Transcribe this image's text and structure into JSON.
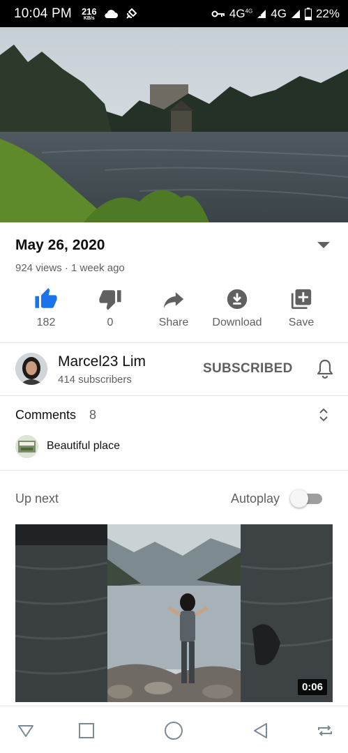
{
  "status_bar": {
    "time": "10:04 PM",
    "speed_value": "216",
    "speed_unit": "KB/s",
    "network_1": "4G",
    "network_1_sup": "4G",
    "network_2": "4G",
    "battery": "22%"
  },
  "video": {
    "date_title": "May 26, 2020",
    "views_line": "924 views · 1 week ago"
  },
  "actions": {
    "like_count": "182",
    "dislike_count": "0",
    "share_label": "Share",
    "download_label": "Download",
    "save_label": "Save"
  },
  "channel": {
    "name": "Marcel23 Lim",
    "subscribers": "414 subscribers",
    "subscribe_state": "SUBSCRIBED"
  },
  "comments": {
    "title": "Comments",
    "count": "8",
    "top_comment": "Beautiful place"
  },
  "up_next": {
    "label": "Up next",
    "autoplay_label": "Autoplay",
    "autoplay_on": false,
    "duration": "0:06"
  },
  "colors": {
    "accent_blue": "#1a73e8",
    "icon_gray": "#606060",
    "text_primary": "#0f0f0f",
    "text_secondary": "#606060"
  },
  "icons": [
    "like-icon",
    "dislike-icon",
    "share-icon",
    "download-icon",
    "save-icon",
    "bell-icon",
    "expand-icon",
    "unfold-icon",
    "nav-back-icon",
    "nav-home-icon",
    "nav-recents-icon",
    "nav-rotate-icon"
  ]
}
